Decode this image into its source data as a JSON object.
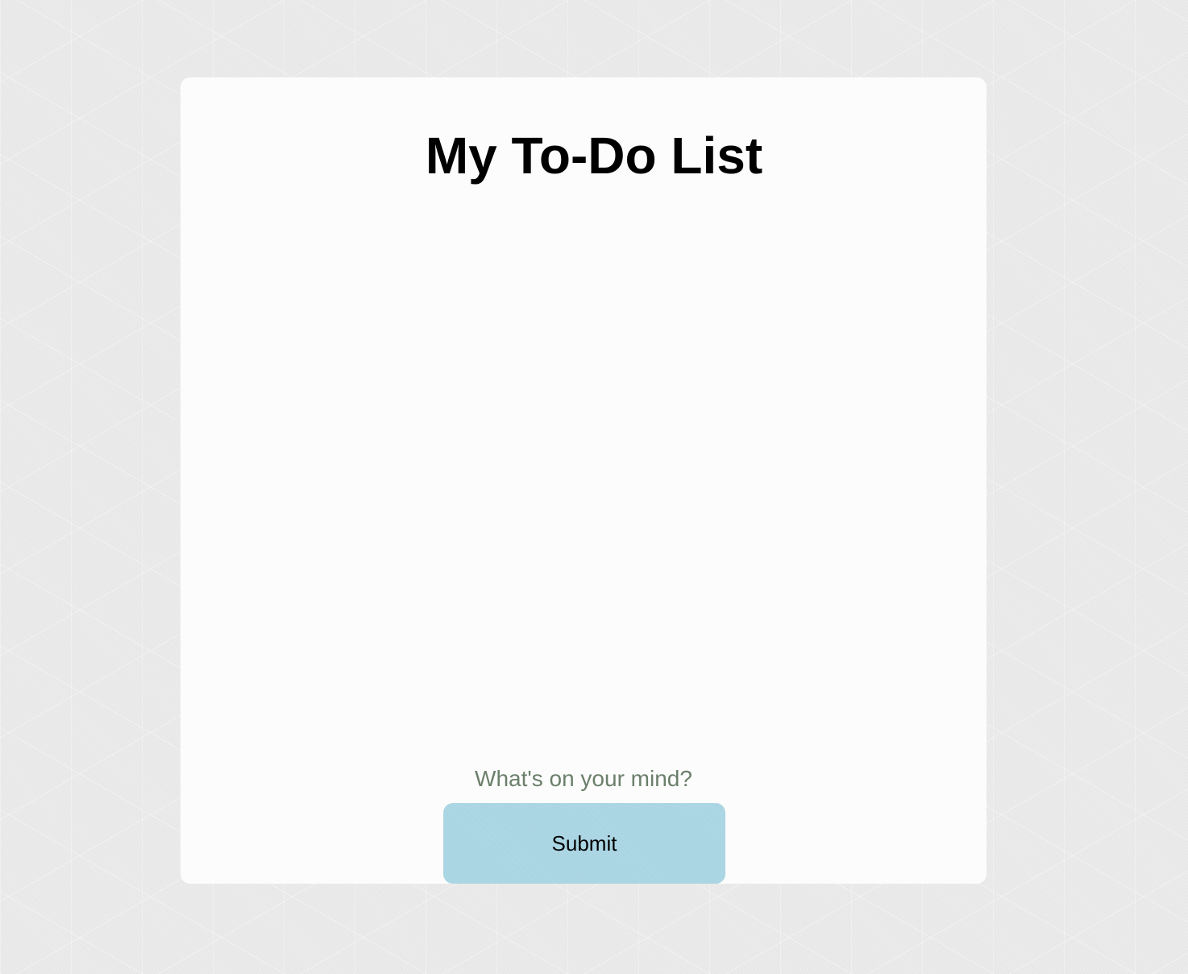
{
  "header": {
    "title": "My To-Do List"
  },
  "todo_list": {
    "items": []
  },
  "input": {
    "value": "",
    "placeholder": "What's on your mind?"
  },
  "actions": {
    "submit_label": "Submit"
  },
  "colors": {
    "page_background": "#ebebeb",
    "card_background": "#fcfcfc",
    "button_background": "#add8e6",
    "placeholder_text": "#6b7f6b",
    "title_text": "#000000"
  }
}
